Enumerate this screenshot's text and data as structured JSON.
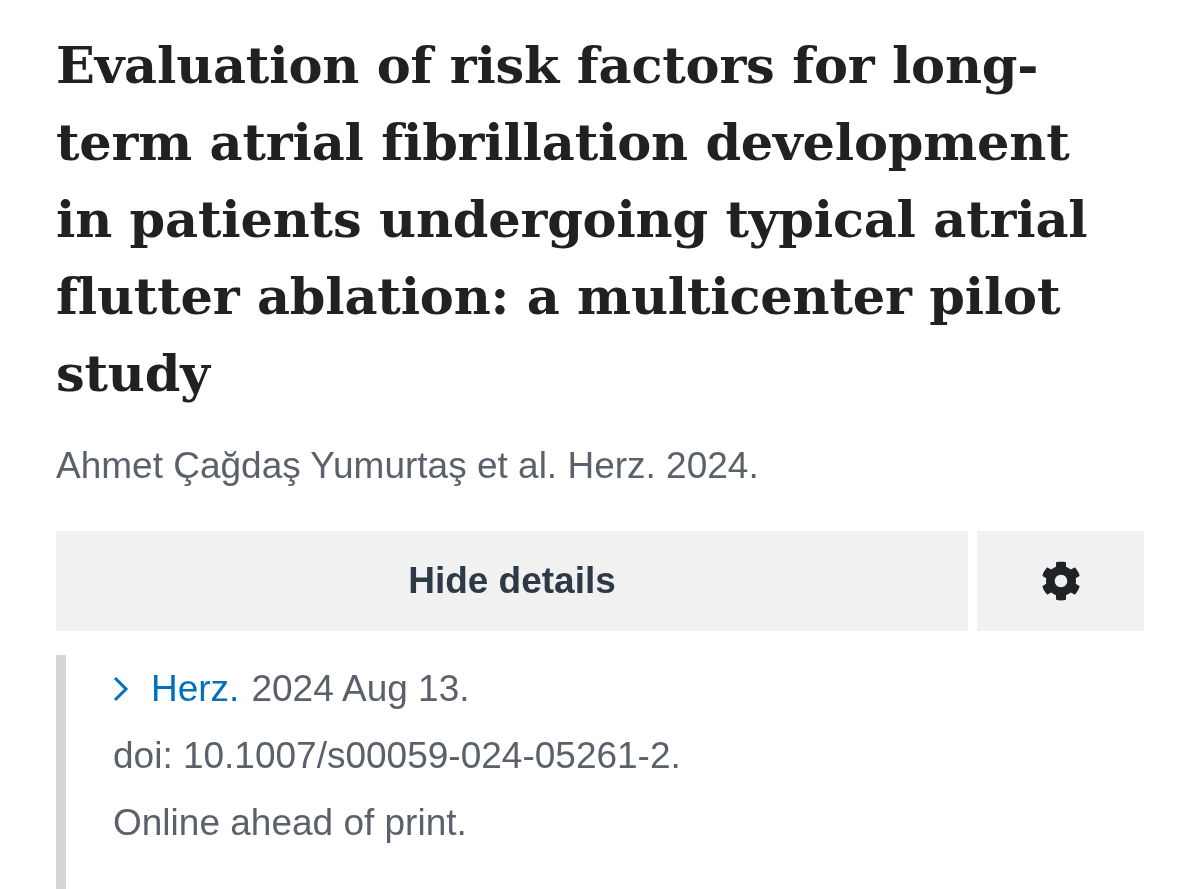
{
  "article": {
    "title": "Evaluation of risk factors for long-term atrial fibrillation development in patients undergoing typical atrial flutter ablation: a multicenter pilot study",
    "citation": "Ahmet Çağdaş Yumurtaş et al. Herz. 2024."
  },
  "actions": {
    "details_button": "Hide details"
  },
  "details": {
    "journal_link": "Herz.",
    "date": "2024 Aug 13.",
    "doi": "doi: 10.1007/s00059-024-05261-2.",
    "status": "Online ahead of print."
  }
}
